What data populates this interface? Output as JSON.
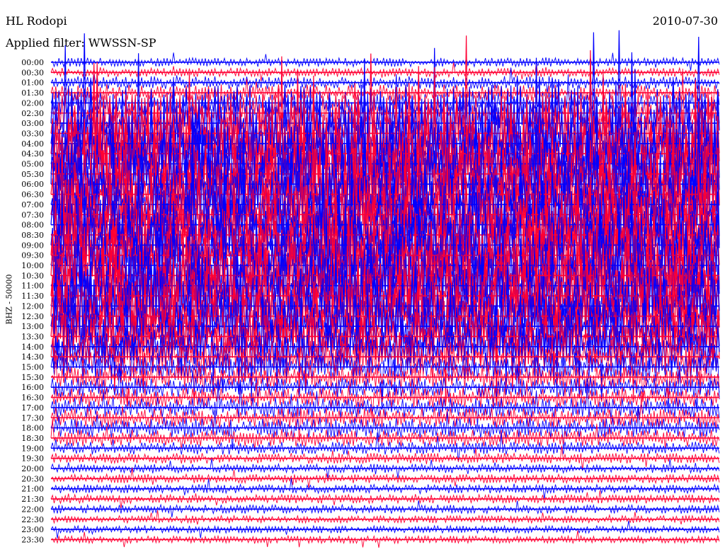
{
  "header": {
    "station": "HL Rodopi",
    "filter": "Applied filter: WWSSN-SP",
    "date": "2010-07-30"
  },
  "colors": {
    "blue": "#0000ff",
    "red": "#ff0033"
  },
  "chart_data": {
    "type": "line",
    "title": "HL Rodopi",
    "subtitle": "Applied filter: WWSSN-SP",
    "date": "2010-07-30",
    "ylabel": "BHZ - 50000",
    "xlabel": "",
    "grid": false,
    "trace_colors": [
      "#0000ff",
      "#ff0033"
    ],
    "row_labels": [
      "00:00",
      "00:30",
      "01:00",
      "01:30",
      "02:00",
      "02:30",
      "03:00",
      "03:30",
      "04:00",
      "04:30",
      "05:00",
      "05:30",
      "06:00",
      "06:30",
      "07:00",
      "07:30",
      "08:00",
      "08:30",
      "09:00",
      "09:30",
      "10:00",
      "10:30",
      "11:00",
      "11:30",
      "12:00",
      "12:30",
      "13:00",
      "13:30",
      "14:00",
      "14:30",
      "15:00",
      "15:30",
      "16:00",
      "16:30",
      "17:00",
      "17:30",
      "18:00",
      "18:30",
      "19:00",
      "19:30",
      "20:00",
      "20:30",
      "21:00",
      "21:30",
      "22:00",
      "22:30",
      "23:00",
      "23:30"
    ],
    "row_activity": [
      0.1,
      0.1,
      0.15,
      0.2,
      0.3,
      0.5,
      1,
      1,
      1,
      1,
      1,
      1,
      1,
      1,
      1,
      1,
      1,
      1,
      1,
      1,
      1,
      1,
      1,
      1,
      1,
      0.9,
      0.8,
      0.7,
      0.6,
      0.5,
      0.35,
      0.3,
      0.25,
      0.25,
      0.25,
      0.25,
      0.25,
      0.2,
      0.15,
      0.12,
      0.1,
      0.1,
      0.1,
      0.1,
      0.1,
      0.08,
      0.08,
      0.08
    ]
  }
}
